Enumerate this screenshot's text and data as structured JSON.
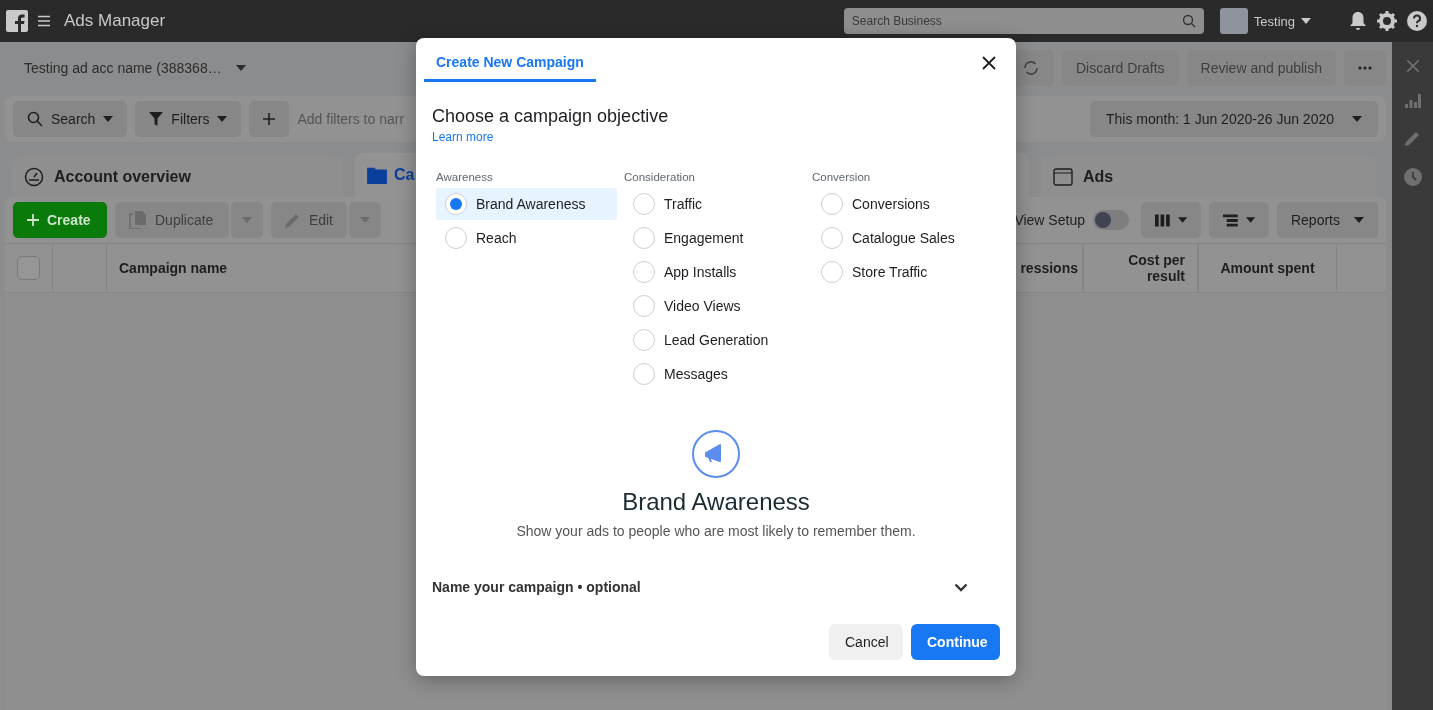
{
  "top_bar": {
    "title": "Ads Manager",
    "search": {
      "placeholder": "Search Business"
    },
    "account": "Testing"
  },
  "account_bar": {
    "account_name": "Testing ad acc name (388368…",
    "buttons": [
      "Discard Drafts",
      "Review and publish"
    ]
  },
  "filter_bar": {
    "search": "Search",
    "filters": "Filters",
    "filter_hint": "Add filters to narr",
    "date_range": "This month: 1 Jun 2020-26 Jun 2020"
  },
  "tabs": [
    {
      "label": "Account overview",
      "selected": false,
      "kind": "overview"
    },
    {
      "label": "Ca",
      "selected": true,
      "kind": "campaigns"
    },
    {
      "label": "Ads",
      "selected": false,
      "kind": "ads"
    }
  ],
  "toolbar": {
    "create": "Create",
    "duplicate": "Duplicate",
    "edit": "Edit",
    "view_setup": {
      "label": "View Setup",
      "on": false
    },
    "reports": "Reports"
  },
  "table": {
    "select_all": {
      "checked": false
    },
    "columns": [
      "Campaign name",
      "ressions",
      "Cost per result",
      "Amount spent"
    ]
  },
  "dialog": {
    "tab": "Create New Campaign",
    "heading": "Choose a campaign objective",
    "learn_more": "Learn more",
    "groups": [
      {
        "title": "Awareness",
        "options": [
          {
            "label": "Brand Awareness",
            "selected": true
          },
          {
            "label": "Reach",
            "selected": false
          }
        ]
      },
      {
        "title": "Consideration",
        "options": [
          {
            "label": "Traffic",
            "selected": false
          },
          {
            "label": "Engagement",
            "selected": false
          },
          {
            "label": "App Installs",
            "selected": false
          },
          {
            "label": "Video Views",
            "selected": false
          },
          {
            "label": "Lead Generation",
            "selected": false
          },
          {
            "label": "Messages",
            "selected": false
          }
        ]
      },
      {
        "title": "Conversion",
        "options": [
          {
            "label": "Conversions",
            "selected": false
          },
          {
            "label": "Catalogue Sales",
            "selected": false
          },
          {
            "label": "Store Traffic",
            "selected": false
          }
        ]
      }
    ],
    "detail": {
      "title": "Brand Awareness",
      "description": "Show your ads to people who are most likely to remember them."
    },
    "name_section": {
      "label": "Name your campaign • optional",
      "expanded": false
    },
    "buttons": [
      {
        "label": "Cancel",
        "kind": "secondary"
      },
      {
        "label": "Continue",
        "kind": "primary"
      }
    ]
  }
}
